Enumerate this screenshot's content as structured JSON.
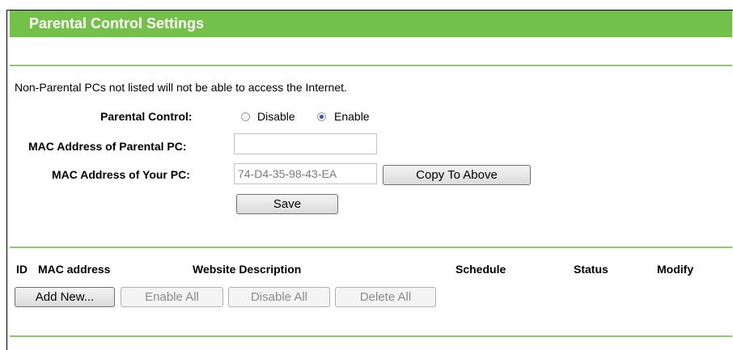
{
  "page": {
    "title": "Parental Control Settings"
  },
  "settings": {
    "note": "Non-Parental PCs not listed will not be able to access the Internet.",
    "parental_control_label": "Parental Control:",
    "disable_label": "Disable",
    "enable_label": "Enable",
    "selected_option": "Enable",
    "parental_mac_label": "MAC Address of Parental PC:",
    "parental_mac_value": "",
    "your_mac_label": "MAC Address of Your PC:",
    "your_mac_value": "74-D4-35-98-43-EA",
    "copy_button": "Copy To Above",
    "save_button": "Save"
  },
  "table": {
    "columns": [
      "ID",
      "MAC address",
      "Website Description",
      "Schedule",
      "Status",
      "Modify"
    ],
    "rows": []
  },
  "actions": {
    "add_new": "Add New...",
    "enable_all": "Enable All",
    "disable_all": "Disable All",
    "delete_all": "Delete All"
  },
  "colors": {
    "title_bar": "#74c14a",
    "divider": "#8fcd6c"
  }
}
